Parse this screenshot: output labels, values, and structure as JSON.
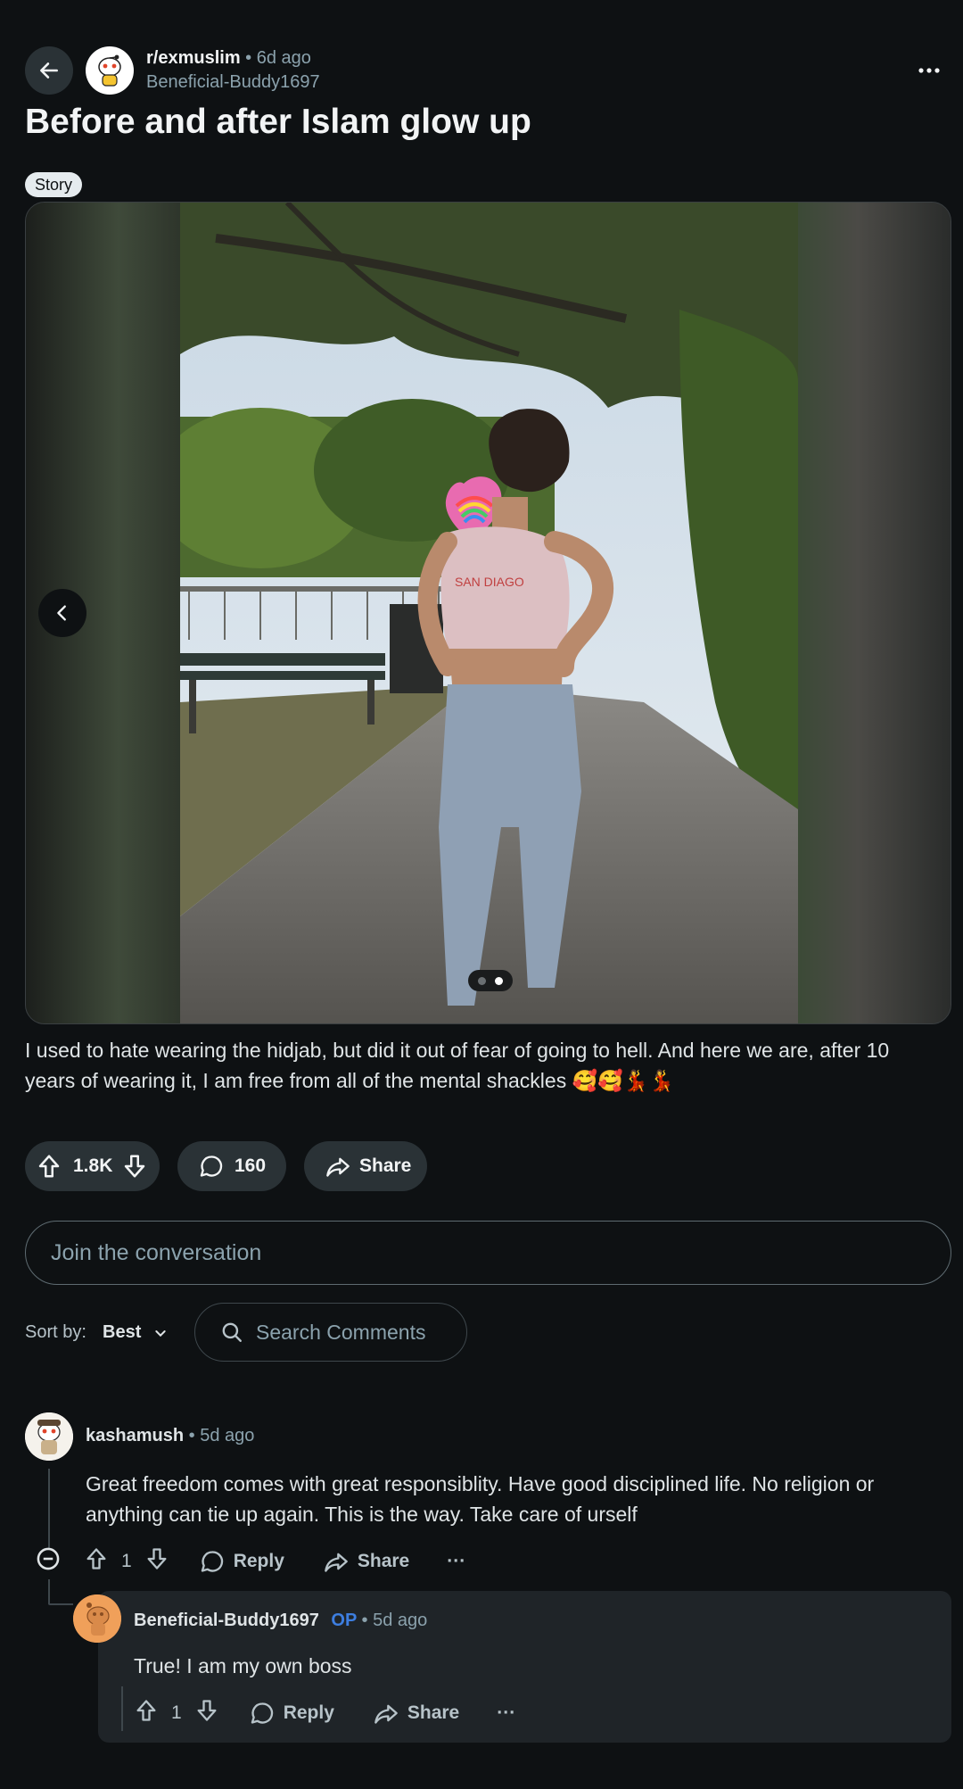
{
  "header": {
    "back_icon": "arrow-left-icon",
    "subreddit": "r/exmuslim",
    "separator": "•",
    "time": "6d ago",
    "author": "Beneficial-Buddy1697",
    "more_icon": "more-horizontal-icon",
    "more_label": "..."
  },
  "post": {
    "title": "Before and after Islam glow up",
    "flair": "Story",
    "body": "I used to hate wearing the hidjab, but did it out of fear of going to hell. And here we are, after 10 years of wearing it, I am free from all of the mental shackles 🥰🥰💃💃",
    "gallery": {
      "total_images": 2,
      "current_index": 2
    }
  },
  "actions": {
    "upvotes": "1.8K",
    "comments": "160",
    "share": "Share"
  },
  "composer": {
    "placeholder": "Join the conversation"
  },
  "sort": {
    "label": "Sort by:",
    "value": "Best",
    "search_placeholder": "Search Comments"
  },
  "comments": [
    {
      "user": "kashamush",
      "separator": "•",
      "time": "5d ago",
      "text": "Great freedom comes with great responsiblity. Have good disciplined life. No religion or anything can tie up again. This is the way. Take care of urself",
      "votes": "1",
      "reply": "Reply",
      "share": "Share",
      "more": "···",
      "replies": [
        {
          "user": "Beneficial-Buddy1697",
          "op_badge": "OP",
          "separator": "•",
          "time": "5d ago",
          "text": "True! I am my own boss",
          "votes": "1",
          "reply": "Reply",
          "share": "Share",
          "more": "···"
        }
      ]
    }
  ],
  "colors": {
    "background": "#0e1113",
    "pill": "#2a3236",
    "op": "#3d7ee0",
    "muted": "#8ba2ad"
  }
}
